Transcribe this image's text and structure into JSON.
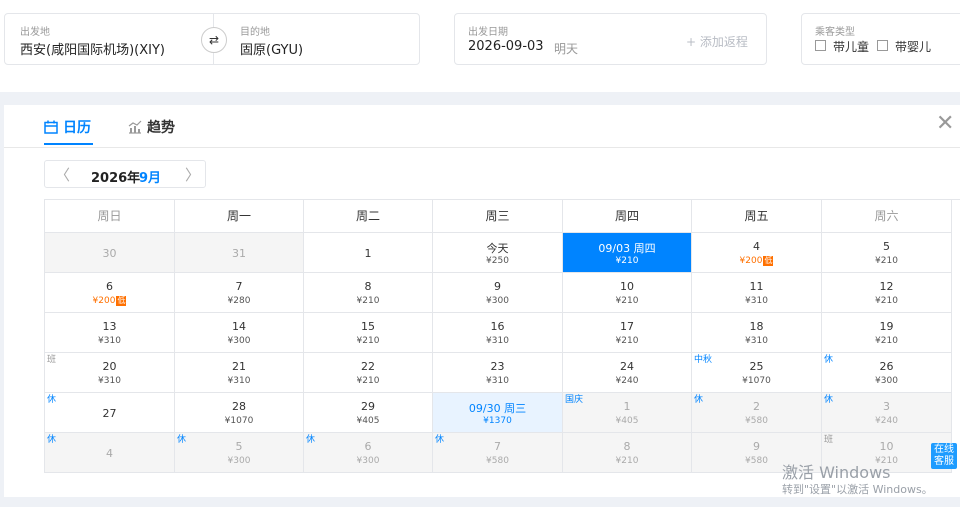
{
  "search": {
    "from_label": "出发地",
    "from_value": "西安(咸阳国际机场)(XIY)",
    "to_label": "目的地",
    "to_value": "固原(GYU)",
    "date_label": "出发日期",
    "date_value": "2026-09-03",
    "date_hint": "明天",
    "add_return": "+ 添加返程",
    "passenger_label": "乘客类型",
    "child": "带儿童",
    "infant": "带婴儿",
    "swap_glyph": "⇄"
  },
  "tabs": {
    "calendar": "日历",
    "trend": "趋势"
  },
  "close_glyph": "✕",
  "month_nav": {
    "year": "2026年",
    "month": "9月",
    "prev": "〈",
    "next": "〉"
  },
  "weekdays": [
    "周日",
    "周一",
    "周二",
    "周三",
    "周四",
    "周五",
    "周六"
  ],
  "low_tag": "低",
  "weeks": [
    [
      {
        "day": "30",
        "price": "",
        "state": "grey"
      },
      {
        "day": "31",
        "price": "",
        "state": "grey"
      },
      {
        "day": "1",
        "price": "",
        "state": "normal"
      },
      {
        "day": "今天",
        "price": "¥250",
        "state": "normal"
      },
      {
        "day": "09/03 周四",
        "price": "¥210",
        "state": "selected"
      },
      {
        "day": "4",
        "price": "¥200",
        "state": "low"
      },
      {
        "day": "5",
        "price": "¥210",
        "state": "normal"
      }
    ],
    [
      {
        "day": "6",
        "price": "¥200",
        "state": "low"
      },
      {
        "day": "7",
        "price": "¥280",
        "state": "normal"
      },
      {
        "day": "8",
        "price": "¥210",
        "state": "normal"
      },
      {
        "day": "9",
        "price": "¥300",
        "state": "normal"
      },
      {
        "day": "10",
        "price": "¥210",
        "state": "normal"
      },
      {
        "day": "11",
        "price": "¥310",
        "state": "normal"
      },
      {
        "day": "12",
        "price": "¥210",
        "state": "normal"
      }
    ],
    [
      {
        "day": "13",
        "price": "¥310",
        "state": "normal"
      },
      {
        "day": "14",
        "price": "¥300",
        "state": "normal"
      },
      {
        "day": "15",
        "price": "¥210",
        "state": "normal"
      },
      {
        "day": "16",
        "price": "¥310",
        "state": "normal"
      },
      {
        "day": "17",
        "price": "¥210",
        "state": "normal"
      },
      {
        "day": "18",
        "price": "¥310",
        "state": "normal"
      },
      {
        "day": "19",
        "price": "¥210",
        "state": "normal"
      }
    ],
    [
      {
        "day": "20",
        "price": "¥310",
        "state": "normal",
        "tag": "班",
        "tag_type": "work"
      },
      {
        "day": "21",
        "price": "¥310",
        "state": "normal"
      },
      {
        "day": "22",
        "price": "¥210",
        "state": "normal"
      },
      {
        "day": "23",
        "price": "¥310",
        "state": "normal"
      },
      {
        "day": "24",
        "price": "¥240",
        "state": "normal"
      },
      {
        "day": "25",
        "price": "¥1070",
        "state": "normal",
        "tag": "中秋",
        "tag_type": "fest"
      },
      {
        "day": "26",
        "price": "¥300",
        "state": "normal",
        "tag": "休",
        "tag_type": "rest"
      }
    ],
    [
      {
        "day": "27",
        "price": "",
        "state": "normal",
        "tag": "休",
        "tag_type": "rest"
      },
      {
        "day": "28",
        "price": "¥1070",
        "state": "normal"
      },
      {
        "day": "29",
        "price": "¥405",
        "state": "normal"
      },
      {
        "day": "09/30 周三",
        "price": "¥1370",
        "state": "range"
      },
      {
        "day": "1",
        "price": "¥405",
        "state": "grey",
        "tag": "国庆",
        "tag_type": "fest"
      },
      {
        "day": "2",
        "price": "¥580",
        "state": "grey",
        "tag": "休",
        "tag_type": "rest"
      },
      {
        "day": "3",
        "price": "¥240",
        "state": "grey",
        "tag": "休",
        "tag_type": "rest"
      }
    ],
    [
      {
        "day": "4",
        "price": "",
        "state": "grey",
        "tag": "休",
        "tag_type": "rest"
      },
      {
        "day": "5",
        "price": "¥300",
        "state": "grey",
        "tag": "休",
        "tag_type": "rest"
      },
      {
        "day": "6",
        "price": "¥300",
        "state": "grey",
        "tag": "休",
        "tag_type": "rest"
      },
      {
        "day": "7",
        "price": "¥580",
        "state": "grey",
        "tag": "休",
        "tag_type": "rest"
      },
      {
        "day": "8",
        "price": "¥210",
        "state": "grey"
      },
      {
        "day": "9",
        "price": "¥580",
        "state": "grey"
      },
      {
        "day": "10",
        "price": "¥210",
        "state": "grey",
        "tag": "班",
        "tag_type": "work"
      }
    ]
  ],
  "online_service": "在线\n客服",
  "watermark": {
    "line1": "激活 Windows",
    "line2": "转到\"设置\"以激活 Windows。"
  },
  "colors": {
    "accent": "#0084ff",
    "low": "#ff7000",
    "range_bg": "#e8f3ff"
  }
}
